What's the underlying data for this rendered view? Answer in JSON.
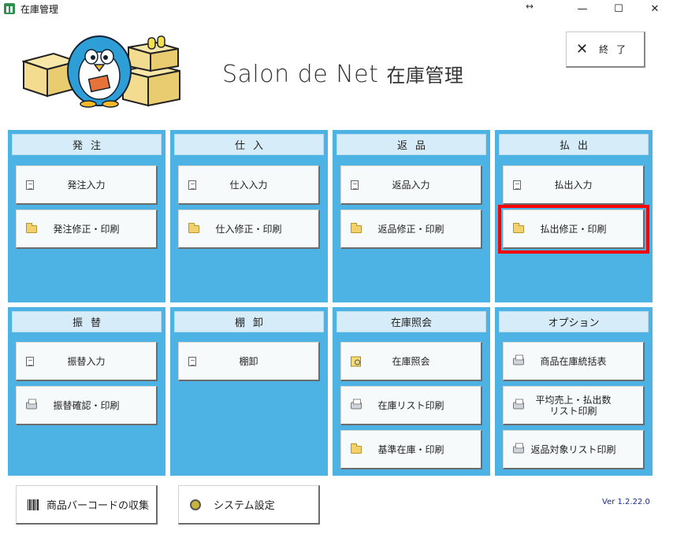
{
  "window": {
    "title": "在庫管理",
    "resize_glyph": "↔",
    "minimize": "—",
    "maximize": "☐",
    "close": "✕"
  },
  "header": {
    "brand": "Salon de Net",
    "brand_jp": "在庫管理"
  },
  "exit_button": {
    "icon": "✕",
    "label": "終了"
  },
  "panels": {
    "order": {
      "title": "発注",
      "buttons": [
        {
          "label": "発注入力",
          "icon": "document-icon"
        },
        {
          "label": "発注修正・印刷",
          "icon": "folder-icon"
        }
      ]
    },
    "purchase": {
      "title": "仕入",
      "buttons": [
        {
          "label": "仕入入力",
          "icon": "document-icon"
        },
        {
          "label": "仕入修正・印刷",
          "icon": "folder-icon"
        }
      ]
    },
    "return": {
      "title": "返品",
      "buttons": [
        {
          "label": "返品入力",
          "icon": "document-icon"
        },
        {
          "label": "返品修正・印刷",
          "icon": "folder-icon"
        }
      ]
    },
    "payout": {
      "title": "払出",
      "buttons": [
        {
          "label": "払出入力",
          "icon": "document-icon"
        },
        {
          "label": "払出修正・印刷",
          "icon": "folder-icon"
        }
      ]
    },
    "transfer": {
      "title": "振替",
      "buttons": [
        {
          "label": "振替入力",
          "icon": "document-icon"
        },
        {
          "label": "振替確認・印刷",
          "icon": "printer-icon"
        }
      ]
    },
    "inventory": {
      "title": "棚卸",
      "buttons": [
        {
          "label": "棚卸",
          "icon": "document-icon"
        }
      ]
    },
    "stock_inquiry": {
      "title": "在庫照会",
      "buttons": [
        {
          "label": "在庫照会",
          "icon": "search-icon"
        },
        {
          "label": "在庫リスト印刷",
          "icon": "printer-icon"
        },
        {
          "label": "基準在庫・印刷",
          "icon": "folder-icon"
        }
      ]
    },
    "options": {
      "title": "オプション",
      "buttons": [
        {
          "label": "商品在庫統括表",
          "icon": "printer-icon"
        },
        {
          "label_line1": "平均売上・払出数",
          "label_line2": "リスト印刷",
          "icon": "printer-icon"
        },
        {
          "label": "返品対象リスト印刷",
          "icon": "printer-icon"
        }
      ]
    }
  },
  "bottom": {
    "barcode_button": "商品バーコードの収集",
    "system_button": "システム設定"
  },
  "version": "Ver  1.2.22.0",
  "colors": {
    "panel_bg": "#4cb3e4",
    "panel_header_bg": "#d6ecf8",
    "highlight": "#ff0000"
  }
}
